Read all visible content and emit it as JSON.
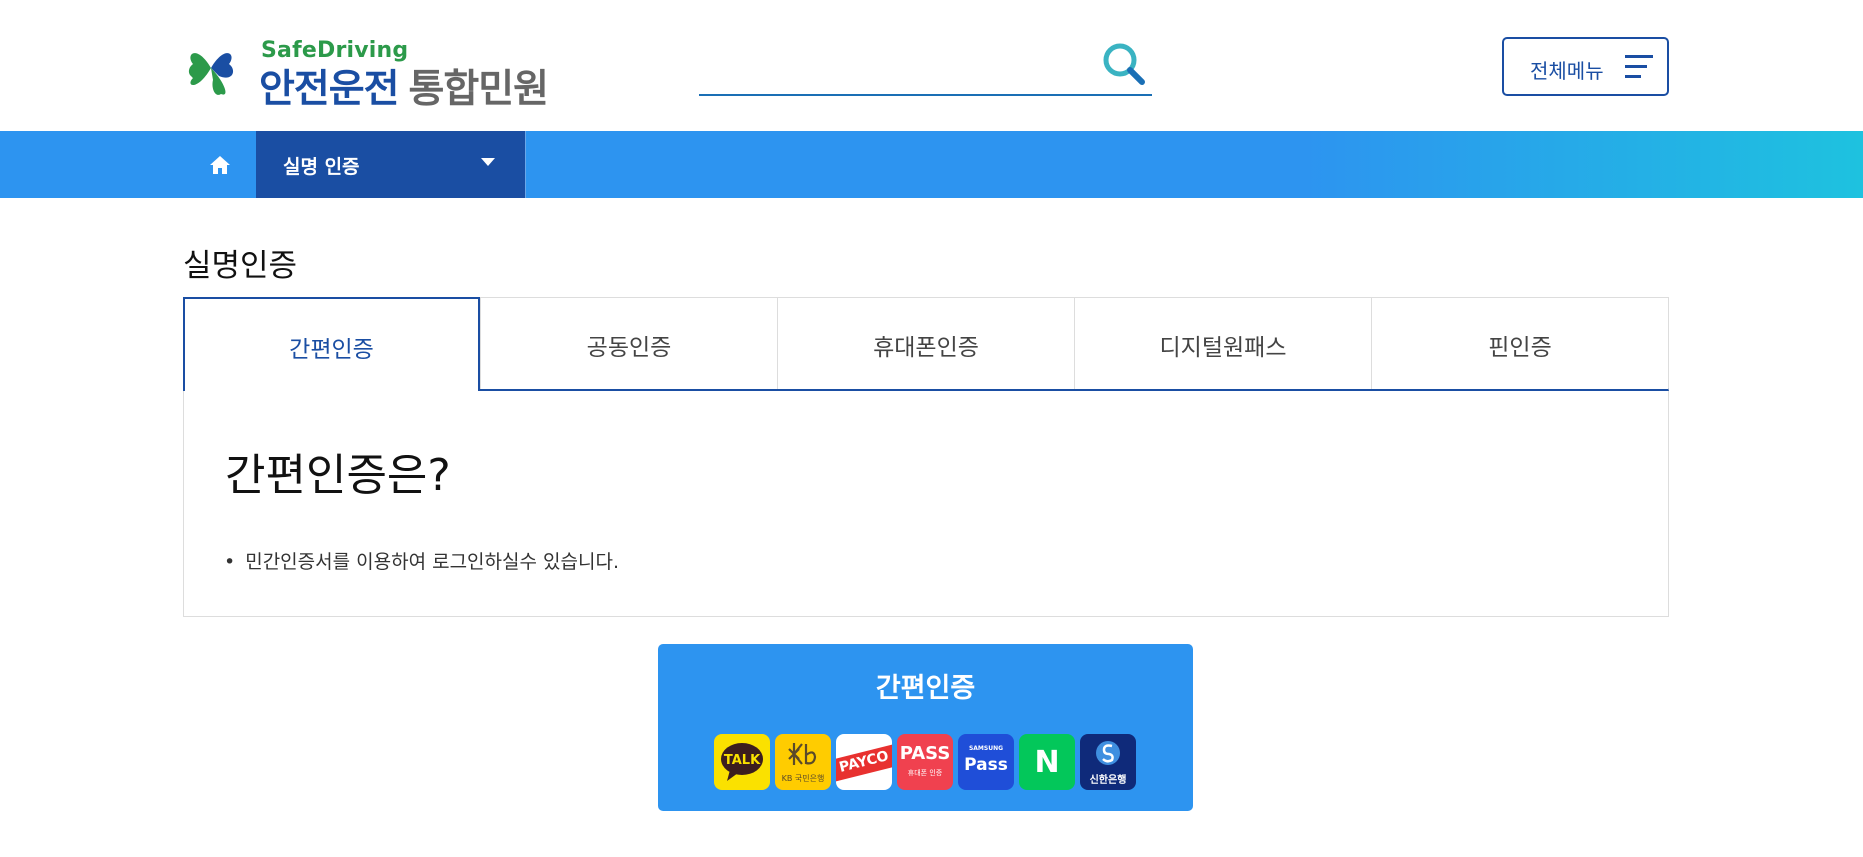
{
  "header": {
    "logo_sub": "SafeDriving",
    "logo_main": "안전운전",
    "logo_main_gray": "통합민원",
    "search_placeholder": "",
    "all_menu_label": "전체메뉴"
  },
  "nav": {
    "current_section": "실명 인증"
  },
  "page": {
    "title": "실명인증"
  },
  "tabs": [
    {
      "label": "간편인증",
      "active": true
    },
    {
      "label": "공동인증",
      "active": false
    },
    {
      "label": "휴대폰인증",
      "active": false
    },
    {
      "label": "디지털원패스",
      "active": false
    },
    {
      "label": "핀인증",
      "active": false
    }
  ],
  "info": {
    "title": "간편인증은?",
    "bullet": "민간인증서를 이용하여 로그인하실수 있습니다."
  },
  "auth_button": {
    "label": "간편인증",
    "providers": [
      {
        "name": "kakao-talk-icon",
        "text": "TALK",
        "bg": "#fae100",
        "fg": "#3c1e1e"
      },
      {
        "name": "kb-bank-icon",
        "text": "KB 국민은행",
        "bg": "#ffcc00",
        "fg": "#5a4a2a"
      },
      {
        "name": "payco-icon",
        "text": "PAYCO",
        "bg": "#ffffff",
        "fg": "#e8312f"
      },
      {
        "name": "pass-icon",
        "text": "PASS",
        "sub": "휴대폰 인증",
        "bg": "#f0414f",
        "fg": "#ffffff"
      },
      {
        "name": "samsung-pass-icon",
        "text": "Pass",
        "sub": "SAMSUNG",
        "bg": "#1f4ed8",
        "fg": "#ffffff"
      },
      {
        "name": "naver-icon",
        "text": "N",
        "bg": "#03c75a",
        "fg": "#ffffff"
      },
      {
        "name": "shinhan-bank-icon",
        "text": "신한은행",
        "bg": "#0f2a7a",
        "fg": "#ffffff"
      }
    ]
  },
  "colors": {
    "brand_blue": "#1a4ea3",
    "nav_blue": "#2d94f0",
    "border_gray": "#dddddd"
  }
}
